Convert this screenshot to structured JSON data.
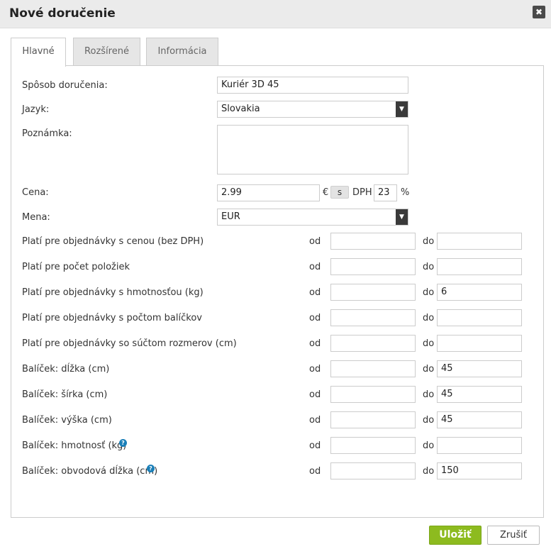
{
  "dialog": {
    "title": "Nové doručenie",
    "close_icon": "✖"
  },
  "tabs": [
    {
      "label": "Hlavné",
      "active": true
    },
    {
      "label": "Rozšírené",
      "active": false
    },
    {
      "label": "Informácia",
      "active": false
    }
  ],
  "form": {
    "shipping_method": {
      "label": "Spôsob doručenia:",
      "value": "Kuriér 3D 45"
    },
    "language": {
      "label": "Jazyk:",
      "value": "Slovakia"
    },
    "note": {
      "label": "Poznámka:",
      "value": ""
    },
    "price": {
      "label": "Cena:",
      "value": "2.99",
      "currency_symbol": "€",
      "s_label": "s",
      "vat_label": "DPH",
      "vat_value": "23",
      "percent": "%"
    },
    "currency": {
      "label": "Mena:",
      "value": "EUR"
    },
    "from_label": "od",
    "to_label": "do",
    "ranges": [
      {
        "label": "Platí pre objednávky s cenou (bez DPH)",
        "from": "",
        "to": "",
        "help": false
      },
      {
        "label": "Platí pre počet položiek",
        "from": "",
        "to": "",
        "help": false
      },
      {
        "label": "Platí pre objednávky s hmotnosťou (kg)",
        "from": "",
        "to": "6",
        "help": false
      },
      {
        "label": "Platí pre objednávky s počtom balíčkov",
        "from": "",
        "to": "",
        "help": false
      },
      {
        "label": "Platí pre objednávky so súčtom rozmerov (cm)",
        "from": "",
        "to": "",
        "help": false
      },
      {
        "label": "Balíček: dĺžka (cm)",
        "from": "",
        "to": "45",
        "help": false
      },
      {
        "label": "Balíček: šírka (cm)",
        "from": "",
        "to": "45",
        "help": false
      },
      {
        "label": "Balíček: výška (cm)",
        "from": "",
        "to": "45",
        "help": false
      },
      {
        "label": "Balíček: hmotnosť (kg)",
        "from": "",
        "to": "",
        "help": true
      },
      {
        "label": "Balíček: obvodová dĺžka (cm)",
        "from": "",
        "to": "150",
        "help": true
      }
    ]
  },
  "footer": {
    "save_label": "Uložiť",
    "cancel_label": "Zrušiť"
  },
  "colors": {
    "save_button": "#8dbb1f",
    "help_icon": "#1a7fb8",
    "select_arrow": "#3a3a3a"
  }
}
